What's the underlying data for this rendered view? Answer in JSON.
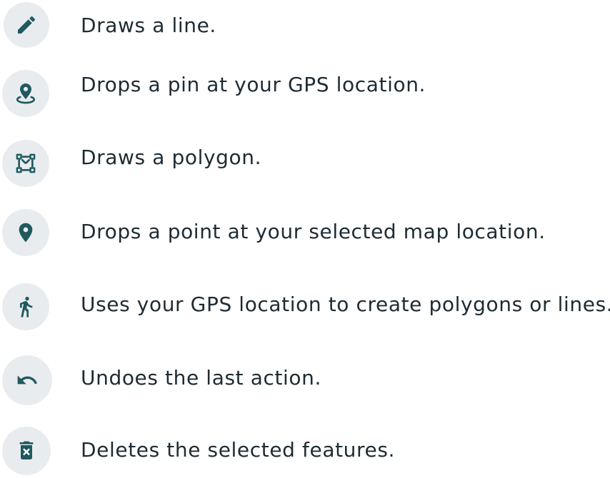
{
  "theme": {
    "icon_color": "#1f5a5f",
    "icon_bg": "#e9ecef",
    "text_color": "#1e2b33"
  },
  "tools": [
    {
      "icon": "pencil-icon",
      "description": "Draws a line."
    },
    {
      "icon": "gps-pin-icon",
      "description": "Drops a pin at your GPS location."
    },
    {
      "icon": "polygon-icon",
      "description": "Draws a polygon."
    },
    {
      "icon": "map-marker-icon",
      "description": "Drops a point at your selected map location."
    },
    {
      "icon": "walking-person-icon",
      "description": "Uses your GPS location to create polygons or lines."
    },
    {
      "icon": "undo-icon",
      "description": "Undoes the last action."
    },
    {
      "icon": "trash-icon",
      "description": "Deletes the selected features."
    }
  ]
}
